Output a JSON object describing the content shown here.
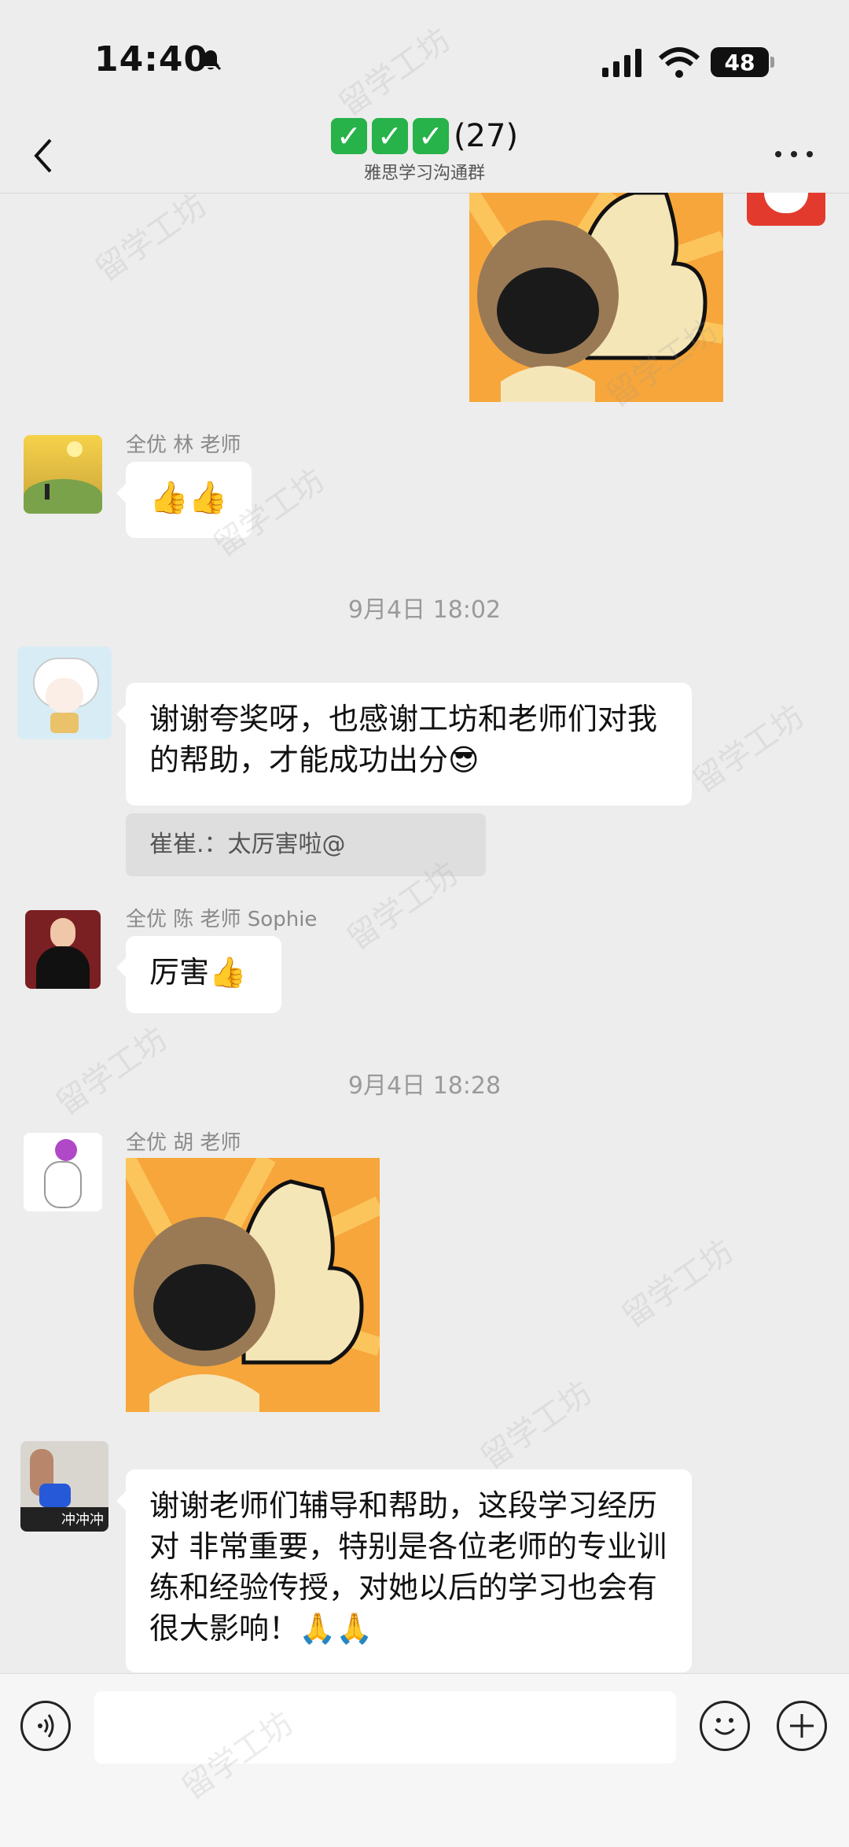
{
  "status_bar": {
    "time": "14:40",
    "battery": "48"
  },
  "header": {
    "title_count": "(27)",
    "subtitle": "雅思学习沟通群",
    "check_icon": "✓"
  },
  "messages": {
    "sender_1": "全优 林 老师",
    "emoji_thumbs": "👍👍",
    "timestamp_1": "9月4日 18:02",
    "msg_2_text": "谢谢夸奖呀，也感谢工坊和老师们对我的帮助，才能成功出分😎",
    "quote_text": "崔崔.：太厉害啦@",
    "sender_3": "全优 陈 老师 Sophie",
    "msg_3_text": "厉害👍",
    "timestamp_2": "9月4日 18:28",
    "sender_4": "全优 胡 老师",
    "msg_5_text": "谢谢老师们辅导和帮助，这段学习经历对        非常重要，特别是各位老师的专业训练和经验传授，对她以后的学习也会有很大影响！🙏🙏",
    "avatar_5_label": "冲冲冲"
  },
  "watermark_text": "留学工坊",
  "colors": {
    "bg": "#ededed",
    "bubble": "#ffffff",
    "check": "#27b24a"
  }
}
